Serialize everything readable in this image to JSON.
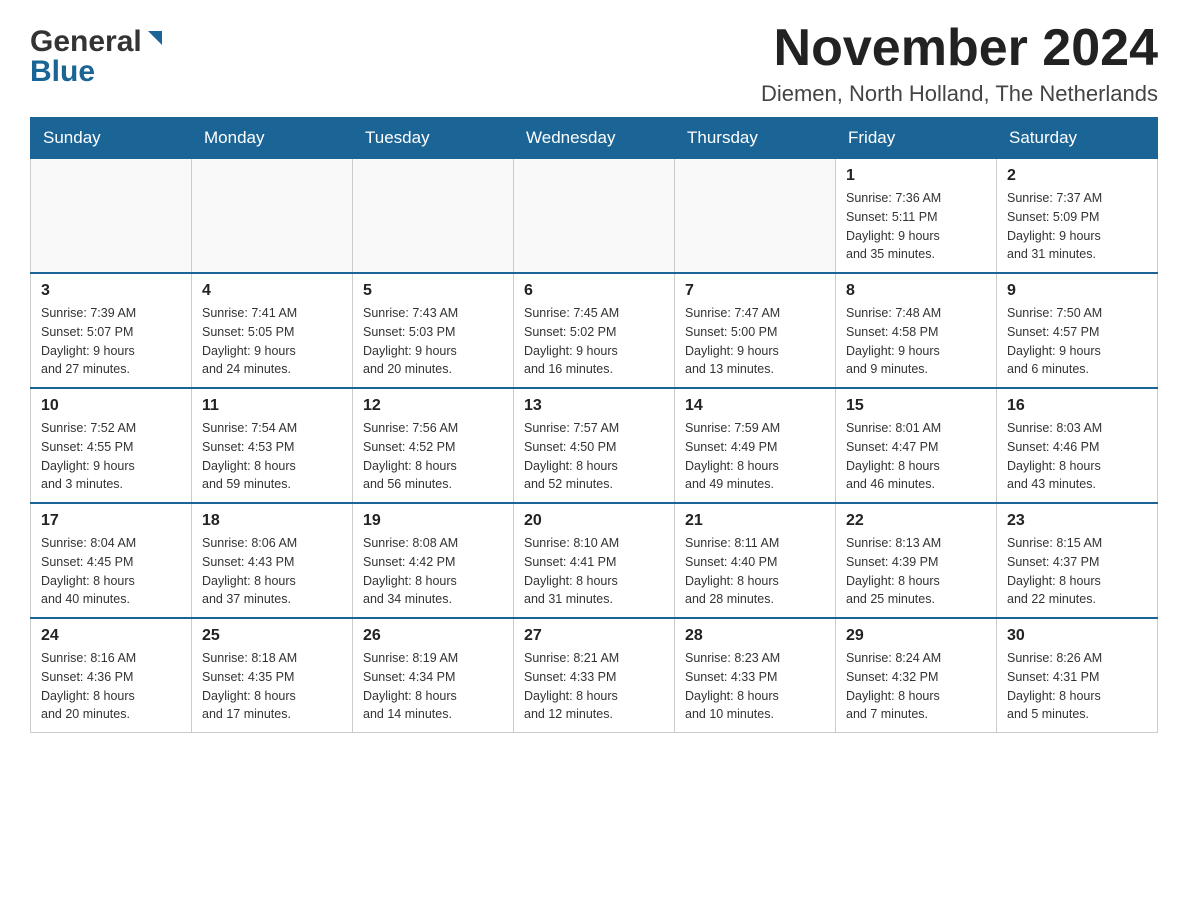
{
  "header": {
    "logo_general": "General",
    "logo_blue": "Blue",
    "month_title": "November 2024",
    "location": "Diemen, North Holland, The Netherlands"
  },
  "days_of_week": [
    "Sunday",
    "Monday",
    "Tuesday",
    "Wednesday",
    "Thursday",
    "Friday",
    "Saturday"
  ],
  "weeks": [
    {
      "days": [
        {
          "number": "",
          "info": ""
        },
        {
          "number": "",
          "info": ""
        },
        {
          "number": "",
          "info": ""
        },
        {
          "number": "",
          "info": ""
        },
        {
          "number": "",
          "info": ""
        },
        {
          "number": "1",
          "info": "Sunrise: 7:36 AM\nSunset: 5:11 PM\nDaylight: 9 hours\nand 35 minutes."
        },
        {
          "number": "2",
          "info": "Sunrise: 7:37 AM\nSunset: 5:09 PM\nDaylight: 9 hours\nand 31 minutes."
        }
      ]
    },
    {
      "days": [
        {
          "number": "3",
          "info": "Sunrise: 7:39 AM\nSunset: 5:07 PM\nDaylight: 9 hours\nand 27 minutes."
        },
        {
          "number": "4",
          "info": "Sunrise: 7:41 AM\nSunset: 5:05 PM\nDaylight: 9 hours\nand 24 minutes."
        },
        {
          "number": "5",
          "info": "Sunrise: 7:43 AM\nSunset: 5:03 PM\nDaylight: 9 hours\nand 20 minutes."
        },
        {
          "number": "6",
          "info": "Sunrise: 7:45 AM\nSunset: 5:02 PM\nDaylight: 9 hours\nand 16 minutes."
        },
        {
          "number": "7",
          "info": "Sunrise: 7:47 AM\nSunset: 5:00 PM\nDaylight: 9 hours\nand 13 minutes."
        },
        {
          "number": "8",
          "info": "Sunrise: 7:48 AM\nSunset: 4:58 PM\nDaylight: 9 hours\nand 9 minutes."
        },
        {
          "number": "9",
          "info": "Sunrise: 7:50 AM\nSunset: 4:57 PM\nDaylight: 9 hours\nand 6 minutes."
        }
      ]
    },
    {
      "days": [
        {
          "number": "10",
          "info": "Sunrise: 7:52 AM\nSunset: 4:55 PM\nDaylight: 9 hours\nand 3 minutes."
        },
        {
          "number": "11",
          "info": "Sunrise: 7:54 AM\nSunset: 4:53 PM\nDaylight: 8 hours\nand 59 minutes."
        },
        {
          "number": "12",
          "info": "Sunrise: 7:56 AM\nSunset: 4:52 PM\nDaylight: 8 hours\nand 56 minutes."
        },
        {
          "number": "13",
          "info": "Sunrise: 7:57 AM\nSunset: 4:50 PM\nDaylight: 8 hours\nand 52 minutes."
        },
        {
          "number": "14",
          "info": "Sunrise: 7:59 AM\nSunset: 4:49 PM\nDaylight: 8 hours\nand 49 minutes."
        },
        {
          "number": "15",
          "info": "Sunrise: 8:01 AM\nSunset: 4:47 PM\nDaylight: 8 hours\nand 46 minutes."
        },
        {
          "number": "16",
          "info": "Sunrise: 8:03 AM\nSunset: 4:46 PM\nDaylight: 8 hours\nand 43 minutes."
        }
      ]
    },
    {
      "days": [
        {
          "number": "17",
          "info": "Sunrise: 8:04 AM\nSunset: 4:45 PM\nDaylight: 8 hours\nand 40 minutes."
        },
        {
          "number": "18",
          "info": "Sunrise: 8:06 AM\nSunset: 4:43 PM\nDaylight: 8 hours\nand 37 minutes."
        },
        {
          "number": "19",
          "info": "Sunrise: 8:08 AM\nSunset: 4:42 PM\nDaylight: 8 hours\nand 34 minutes."
        },
        {
          "number": "20",
          "info": "Sunrise: 8:10 AM\nSunset: 4:41 PM\nDaylight: 8 hours\nand 31 minutes."
        },
        {
          "number": "21",
          "info": "Sunrise: 8:11 AM\nSunset: 4:40 PM\nDaylight: 8 hours\nand 28 minutes."
        },
        {
          "number": "22",
          "info": "Sunrise: 8:13 AM\nSunset: 4:39 PM\nDaylight: 8 hours\nand 25 minutes."
        },
        {
          "number": "23",
          "info": "Sunrise: 8:15 AM\nSunset: 4:37 PM\nDaylight: 8 hours\nand 22 minutes."
        }
      ]
    },
    {
      "days": [
        {
          "number": "24",
          "info": "Sunrise: 8:16 AM\nSunset: 4:36 PM\nDaylight: 8 hours\nand 20 minutes."
        },
        {
          "number": "25",
          "info": "Sunrise: 8:18 AM\nSunset: 4:35 PM\nDaylight: 8 hours\nand 17 minutes."
        },
        {
          "number": "26",
          "info": "Sunrise: 8:19 AM\nSunset: 4:34 PM\nDaylight: 8 hours\nand 14 minutes."
        },
        {
          "number": "27",
          "info": "Sunrise: 8:21 AM\nSunset: 4:33 PM\nDaylight: 8 hours\nand 12 minutes."
        },
        {
          "number": "28",
          "info": "Sunrise: 8:23 AM\nSunset: 4:33 PM\nDaylight: 8 hours\nand 10 minutes."
        },
        {
          "number": "29",
          "info": "Sunrise: 8:24 AM\nSunset: 4:32 PM\nDaylight: 8 hours\nand 7 minutes."
        },
        {
          "number": "30",
          "info": "Sunrise: 8:26 AM\nSunset: 4:31 PM\nDaylight: 8 hours\nand 5 minutes."
        }
      ]
    }
  ]
}
